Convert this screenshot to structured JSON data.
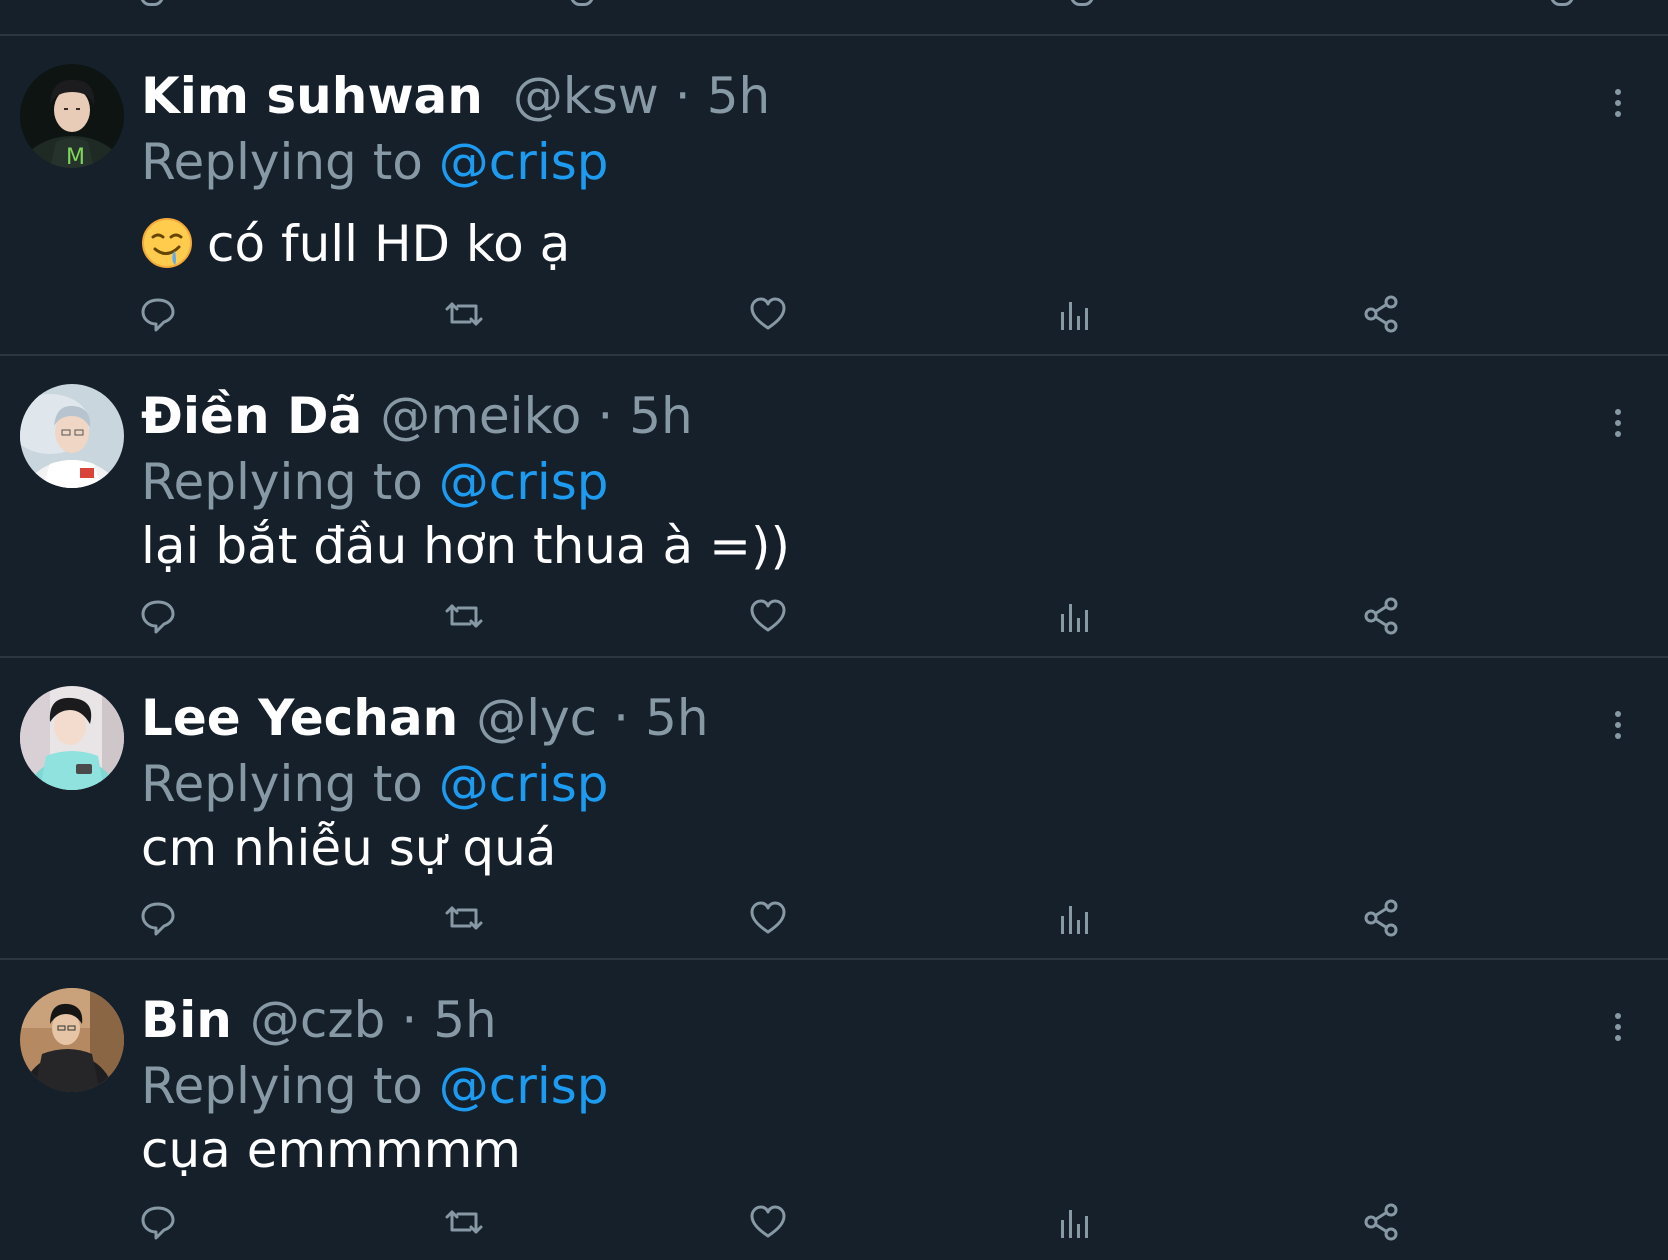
{
  "colors": {
    "background": "#15202b",
    "divider": "#2b3640",
    "secondary_text": "#8899a6",
    "mention": "#1d9bf0",
    "primary_text": "#ffffff"
  },
  "icons": [
    "reply-icon",
    "retweet-icon",
    "like-icon",
    "analytics-icon",
    "share-icon",
    "more-icon"
  ],
  "tweets": [
    {
      "name": "Kim suhwan",
      "handle": "@ksw",
      "separator": "·",
      "time": "5h",
      "replying_label": "Replying to",
      "mention": "@crisp",
      "text": "có full HD ko  ạ",
      "emoji": "drooling-face"
    },
    {
      "name": "Điền Dã",
      "handle": "@meiko",
      "separator": "·",
      "time": "5h",
      "replying_label": "Replying to",
      "mention": "@crisp",
      "text": "lại bắt đầu hơn thua à =))"
    },
    {
      "name": "Lee Yechan",
      "handle": "@lyc",
      "separator": "·",
      "time": "5h",
      "replying_label": "Replying to",
      "mention": "@crisp",
      "text": "cm nhiễu sự quá"
    },
    {
      "name": "Bin",
      "handle": "@czb",
      "separator": "·",
      "time": "5h",
      "replying_label": "Replying to",
      "mention": "@crisp",
      "text": "cụa emmmmm"
    }
  ]
}
